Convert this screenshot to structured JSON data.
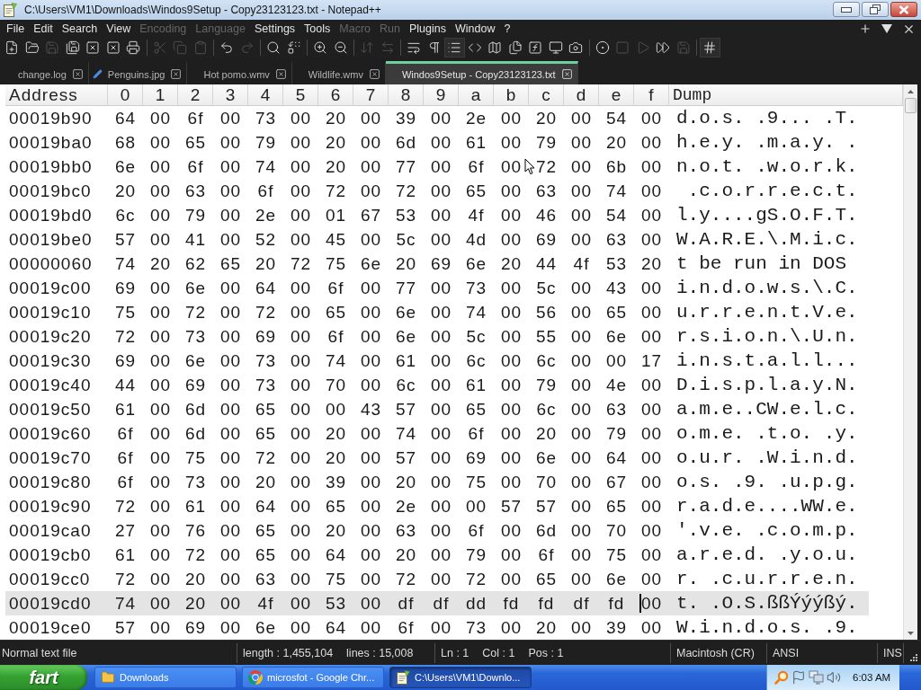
{
  "window": {
    "title": "C:\\Users\\VM1\\Downloads\\Windos9Setup - Copy23123123.txt - Notepad++"
  },
  "menu": [
    {
      "label": "File",
      "disabled": false
    },
    {
      "label": "Edit",
      "disabled": false
    },
    {
      "label": "Search",
      "disabled": false
    },
    {
      "label": "View",
      "disabled": false
    },
    {
      "label": "Encoding",
      "disabled": true
    },
    {
      "label": "Language",
      "disabled": true
    },
    {
      "label": "Settings",
      "disabled": false
    },
    {
      "label": "Tools",
      "disabled": false
    },
    {
      "label": "Macro",
      "disabled": true
    },
    {
      "label": "Run",
      "disabled": true
    },
    {
      "label": "Plugins",
      "disabled": false
    },
    {
      "label": "Window",
      "disabled": false
    },
    {
      "label": "?",
      "disabled": false
    }
  ],
  "toolbar": [
    [
      {
        "disabled": false,
        "pressed": false
      },
      {
        "disabled": false,
        "pressed": false
      },
      {
        "disabled": true,
        "pressed": false
      },
      {
        "disabled": false,
        "pressed": false
      },
      {
        "disabled": false,
        "pressed": false
      },
      {
        "disabled": false,
        "pressed": false
      },
      {
        "disabled": false,
        "pressed": false
      }
    ],
    [
      {
        "disabled": true,
        "pressed": false
      },
      {
        "disabled": true,
        "pressed": false
      },
      {
        "disabled": true,
        "pressed": false
      }
    ],
    [
      {
        "disabled": false,
        "pressed": false
      },
      {
        "disabled": true,
        "pressed": false
      }
    ],
    [
      {
        "disabled": false,
        "pressed": false
      },
      {
        "disabled": false,
        "pressed": false
      }
    ],
    [
      {
        "disabled": false,
        "pressed": false
      },
      {
        "disabled": false,
        "pressed": false
      }
    ],
    [
      {
        "disabled": true,
        "pressed": false
      },
      {
        "disabled": true,
        "pressed": false
      }
    ],
    [
      {
        "disabled": false,
        "pressed": false
      },
      {
        "disabled": false,
        "pressed": false
      },
      {
        "disabled": false,
        "pressed": true
      },
      {
        "disabled": false,
        "pressed": false
      },
      {
        "disabled": false,
        "pressed": false
      },
      {
        "disabled": false,
        "pressed": false
      },
      {
        "disabled": false,
        "pressed": false
      },
      {
        "disabled": false,
        "pressed": false
      },
      {
        "disabled": false,
        "pressed": false
      }
    ],
    [
      {
        "disabled": false,
        "pressed": false
      },
      {
        "disabled": true,
        "pressed": false
      },
      {
        "disabled": true,
        "pressed": false
      },
      {
        "disabled": false,
        "pressed": false
      },
      {
        "disabled": true,
        "pressed": false
      }
    ],
    [
      {
        "disabled": false,
        "pressed": true
      }
    ]
  ],
  "tabs": [
    {
      "label": "change.log",
      "selected": false,
      "modified": false
    },
    {
      "label": "Penguins.jpg",
      "selected": false,
      "modified": true
    },
    {
      "label": "Hot pomo.wmv",
      "selected": false,
      "modified": false
    },
    {
      "label": "Wildlife.wmv",
      "selected": false,
      "modified": false
    },
    {
      "label": "Windos9Setup - Copy23123123.txt",
      "selected": true,
      "modified": false
    }
  ],
  "hex_view": {
    "columns": [
      "Address",
      "0",
      "1",
      "2",
      "3",
      "4",
      "5",
      "6",
      "7",
      "8",
      "9",
      "a",
      "b",
      "c",
      "d",
      "e",
      "f",
      "Dump"
    ],
    "rows": [
      {
        "address": "00019b90",
        "bytes": [
          "64",
          "00",
          "6f",
          "00",
          "73",
          "00",
          "20",
          "00",
          "39",
          "00",
          "2e",
          "00",
          "20",
          "00",
          "54",
          "00"
        ],
        "dump": "d.o.s. .9... .T.",
        "selected": false
      },
      {
        "address": "00019ba0",
        "bytes": [
          "68",
          "00",
          "65",
          "00",
          "79",
          "00",
          "20",
          "00",
          "6d",
          "00",
          "61",
          "00",
          "79",
          "00",
          "20",
          "00"
        ],
        "dump": "h.e.y. .m.a.y. .",
        "selected": false
      },
      {
        "address": "00019bb0",
        "bytes": [
          "6e",
          "00",
          "6f",
          "00",
          "74",
          "00",
          "20",
          "00",
          "77",
          "00",
          "6f",
          "00",
          "72",
          "00",
          "6b",
          "00"
        ],
        "dump": "n.o.t. .w.o.r.k.",
        "selected": false
      },
      {
        "address": "00019bc0",
        "bytes": [
          "20",
          "00",
          "63",
          "00",
          "6f",
          "00",
          "72",
          "00",
          "72",
          "00",
          "65",
          "00",
          "63",
          "00",
          "74",
          "00"
        ],
        "dump": " .c.o.r.r.e.c.t.",
        "selected": false
      },
      {
        "address": "00019bd0",
        "bytes": [
          "6c",
          "00",
          "79",
          "00",
          "2e",
          "00",
          "01",
          "67",
          "53",
          "00",
          "4f",
          "00",
          "46",
          "00",
          "54",
          "00"
        ],
        "dump": "l.y....gS.O.F.T.",
        "selected": false
      },
      {
        "address": "00019be0",
        "bytes": [
          "57",
          "00",
          "41",
          "00",
          "52",
          "00",
          "45",
          "00",
          "5c",
          "00",
          "4d",
          "00",
          "69",
          "00",
          "63",
          "00"
        ],
        "dump": "W.A.R.E.\\.M.i.c.",
        "selected": false
      },
      {
        "address": "00000060",
        "bytes": [
          "74",
          "20",
          "62",
          "65",
          "20",
          "72",
          "75",
          "6e",
          "20",
          "69",
          "6e",
          "20",
          "44",
          "4f",
          "53",
          "20"
        ],
        "dump": "t be run in DOS",
        "selected": false
      },
      {
        "address": "00019c00",
        "bytes": [
          "69",
          "00",
          "6e",
          "00",
          "64",
          "00",
          "6f",
          "00",
          "77",
          "00",
          "73",
          "00",
          "5c",
          "00",
          "43",
          "00"
        ],
        "dump": "i.n.d.o.w.s.\\.C.",
        "selected": false
      },
      {
        "address": "00019c10",
        "bytes": [
          "75",
          "00",
          "72",
          "00",
          "72",
          "00",
          "65",
          "00",
          "6e",
          "00",
          "74",
          "00",
          "56",
          "00",
          "65",
          "00"
        ],
        "dump": "u.r.r.e.n.t.V.e.",
        "selected": false
      },
      {
        "address": "00019c20",
        "bytes": [
          "72",
          "00",
          "73",
          "00",
          "69",
          "00",
          "6f",
          "00",
          "6e",
          "00",
          "5c",
          "00",
          "55",
          "00",
          "6e",
          "00"
        ],
        "dump": "r.s.i.o.n.\\.U.n.",
        "selected": false
      },
      {
        "address": "00019c30",
        "bytes": [
          "69",
          "00",
          "6e",
          "00",
          "73",
          "00",
          "74",
          "00",
          "61",
          "00",
          "6c",
          "00",
          "6c",
          "00",
          "00",
          "17"
        ],
        "dump": "i.n.s.t.a.l.l...",
        "selected": false
      },
      {
        "address": "00019c40",
        "bytes": [
          "44",
          "00",
          "69",
          "00",
          "73",
          "00",
          "70",
          "00",
          "6c",
          "00",
          "61",
          "00",
          "79",
          "00",
          "4e",
          "00"
        ],
        "dump": "D.i.s.p.l.a.y.N.",
        "selected": false
      },
      {
        "address": "00019c50",
        "bytes": [
          "61",
          "00",
          "6d",
          "00",
          "65",
          "00",
          "00",
          "43",
          "57",
          "00",
          "65",
          "00",
          "6c",
          "00",
          "63",
          "00"
        ],
        "dump": "a.m.e..CW.e.l.c.",
        "selected": false
      },
      {
        "address": "00019c60",
        "bytes": [
          "6f",
          "00",
          "6d",
          "00",
          "65",
          "00",
          "20",
          "00",
          "74",
          "00",
          "6f",
          "00",
          "20",
          "00",
          "79",
          "00"
        ],
        "dump": "o.m.e. .t.o. .y.",
        "selected": false
      },
      {
        "address": "00019c70",
        "bytes": [
          "6f",
          "00",
          "75",
          "00",
          "72",
          "00",
          "20",
          "00",
          "57",
          "00",
          "69",
          "00",
          "6e",
          "00",
          "64",
          "00"
        ],
        "dump": "o.u.r. .W.i.n.d.",
        "selected": false
      },
      {
        "address": "00019c80",
        "bytes": [
          "6f",
          "00",
          "73",
          "00",
          "20",
          "00",
          "39",
          "00",
          "20",
          "00",
          "75",
          "00",
          "70",
          "00",
          "67",
          "00"
        ],
        "dump": "o.s. .9. .u.p.g.",
        "selected": false
      },
      {
        "address": "00019c90",
        "bytes": [
          "72",
          "00",
          "61",
          "00",
          "64",
          "00",
          "65",
          "00",
          "2e",
          "00",
          "00",
          "57",
          "57",
          "00",
          "65",
          "00"
        ],
        "dump": "r.a.d.e....WW.e.",
        "selected": false
      },
      {
        "address": "00019ca0",
        "bytes": [
          "27",
          "00",
          "76",
          "00",
          "65",
          "00",
          "20",
          "00",
          "63",
          "00",
          "6f",
          "00",
          "6d",
          "00",
          "70",
          "00"
        ],
        "dump": "'.v.e. .c.o.m.p.",
        "selected": false
      },
      {
        "address": "00019cb0",
        "bytes": [
          "61",
          "00",
          "72",
          "00",
          "65",
          "00",
          "64",
          "00",
          "20",
          "00",
          "79",
          "00",
          "6f",
          "00",
          "75",
          "00"
        ],
        "dump": "a.r.e.d. .y.o.u.",
        "selected": false
      },
      {
        "address": "00019cc0",
        "bytes": [
          "72",
          "00",
          "20",
          "00",
          "63",
          "00",
          "75",
          "00",
          "72",
          "00",
          "72",
          "00",
          "65",
          "00",
          "6e",
          "00"
        ],
        "dump": "r. .c.u.r.r.e.n.",
        "selected": false
      },
      {
        "address": "00019cd0",
        "bytes": [
          "74",
          "00",
          "20",
          "00",
          "4f",
          "00",
          "53",
          "00",
          "df",
          "df",
          "dd",
          "fd",
          "fd",
          "df",
          "fd",
          "00"
        ],
        "dump": "t. .O.S.ßßÝýýßý.",
        "selected": true
      },
      {
        "address": "00019ce0",
        "bytes": [
          "57",
          "00",
          "69",
          "00",
          "6e",
          "00",
          "64",
          "00",
          "6f",
          "00",
          "73",
          "00",
          "20",
          "00",
          "39",
          "00"
        ],
        "dump": "W.i.n.d.o.s. .9.",
        "selected": false
      }
    ]
  },
  "status_bar": {
    "file_type": "Normal text file",
    "length": "length : 1,455,104",
    "lines": "lines : 15,008",
    "line": "Ln : 1",
    "column": "Col : 1",
    "position": "Pos : 1",
    "eol": "Macintosh (CR)",
    "encoding": "ANSI",
    "mode": "INS"
  },
  "taskbar": {
    "start": "fart",
    "tasks": [
      {
        "label": "Downloads",
        "selected": false
      },
      {
        "label": "microsfot - Google Chr...",
        "selected": false
      },
      {
        "label": "C:\\Users\\VM1\\Downlo...",
        "selected": true
      }
    ],
    "clock": "6:03 AM"
  }
}
